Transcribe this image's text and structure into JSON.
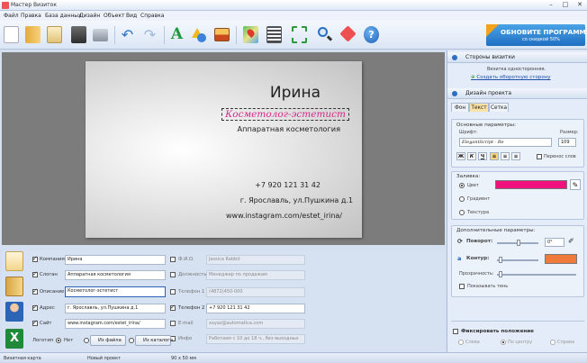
{
  "window": {
    "title": "Мастер Визиток",
    "controls": [
      "–",
      "□",
      "✕"
    ]
  },
  "menu": [
    "Файл",
    "Правка",
    "База данных",
    "Дизайн",
    "Объект",
    "Вид",
    "Справка"
  ],
  "toolbar": {
    "icons": [
      "new-icon",
      "open-icon",
      "templates-icon",
      "save-icon",
      "print-icon",
      "undo-icon",
      "redo-icon",
      "add-text-icon",
      "add-shape-icon",
      "add-image-icon",
      "map-icon",
      "qr-code-icon",
      "crop-icon",
      "zoom-icon",
      "effects-icon",
      "help-icon"
    ],
    "promo": {
      "title": "ОБНОВИТЕ ПРОГРАММУ",
      "subtitle": "со скидкой 50%"
    }
  },
  "card": {
    "name": "Ирина",
    "title": "Косметолог-эстетист",
    "description": "Аппаратная косметология",
    "phone": "+7 920 121 31 42",
    "address": "г. Ярославль, ул.Пушкина д.1",
    "site": "www.instagram.com/estet_irina/"
  },
  "fields": {
    "left": [
      {
        "label": "Компания",
        "value": "Ирина",
        "checked": true
      },
      {
        "label": "Слоган",
        "value": "Аппаратная косметология",
        "checked": true
      },
      {
        "label": "Описание",
        "value": "Косметолог-эстетист",
        "checked": true
      },
      {
        "label": "Адрес",
        "value": "г. Ярославль, ул.Пушкина д.1",
        "checked": true
      },
      {
        "label": "Сайт",
        "value": "www.instagram.com/estet_irina/",
        "checked": true
      }
    ],
    "right": [
      {
        "label": "Ф.И.О.",
        "value": "Jessica Rabbit",
        "checked": false
      },
      {
        "label": "Должность",
        "value": "Менеджер по продажам",
        "checked": false
      },
      {
        "label": "Телефон 1",
        "value": "(4872)450-000",
        "checked": false
      },
      {
        "label": "Телефон 2",
        "value": "+7 920 121 31 42",
        "checked": true
      },
      {
        "label": "E-mail",
        "value": "xxyaz@automatica.com",
        "checked": false
      },
      {
        "label": "Инфо",
        "value": "Работаем с 10 до 18 ч., без выходных",
        "checked": false
      }
    ],
    "logo": {
      "label": "Логотип",
      "none": "Нет",
      "from_file": "Из файла",
      "from_catalog": "Из каталога"
    }
  },
  "panel": {
    "sides_header": "Стороны визитки",
    "sides_text": "Визитка односторонняя.",
    "sides_link": "Создать оборотную сторону",
    "design_header": "Дизайн проекта",
    "tabs": [
      "Фон",
      "Текст",
      "Сетка"
    ],
    "basic": "Основные параметры:",
    "font_label": "Шрифт:",
    "size_label": "Размер:",
    "font_value": "ElegantScript - Re",
    "size_value": "109",
    "wrap_label": "Перенос слов",
    "format_buttons": [
      "Ж",
      "К",
      "Ч"
    ],
    "fill": "Заливка:",
    "fill_options": [
      "Цвет",
      "Градиент",
      "Текстура"
    ],
    "fill_color": "#f0127e",
    "extra": "Дополнительные параметры:",
    "rotation_label": "Поворот:",
    "rotation_value": "0°",
    "outline_label": "Контур:",
    "outline_color": "#f07a3a",
    "opacity_label": "Прозрачность:",
    "shadow_label": "Показывать тень",
    "fix_label": "Фиксировать положение",
    "fix_options": [
      "Слева",
      "По центру",
      "Справа"
    ]
  },
  "status": {
    "left": "Визитная карта",
    "project": "Новый проект",
    "size": "90 x 50 мм"
  }
}
